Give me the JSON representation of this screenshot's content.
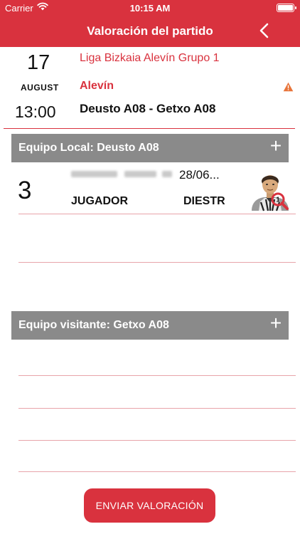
{
  "status_bar": {
    "carrier": "Carrier",
    "time": "10:15 AM"
  },
  "header": {
    "title": "Valoración del partido"
  },
  "match_info": {
    "day": "17",
    "month": "AUGUST",
    "time": "13:00",
    "league": "Liga Bizkaia Alevín Grupo 1",
    "category": "Alevín",
    "teams": "Deusto A08 - Getxo A08"
  },
  "home_team": {
    "label": "Equipo Local: Deusto A08",
    "players": [
      {
        "number": "3",
        "birth_date": "28/06...",
        "role": "JUGADOR",
        "foot": "DIESTR"
      }
    ]
  },
  "away_team": {
    "label": "Equipo visitante: Getxo A08"
  },
  "actions": {
    "send_label": "ENVIAR VALORACIÓN"
  },
  "colors": {
    "brand_red": "#d9323e",
    "team_bar_gray": "#8a8a8a"
  },
  "icons": [
    "wifi-icon",
    "battery-icon",
    "back-chevron-icon",
    "warning-icon",
    "plus-icon",
    "player-avatar-icon"
  ]
}
